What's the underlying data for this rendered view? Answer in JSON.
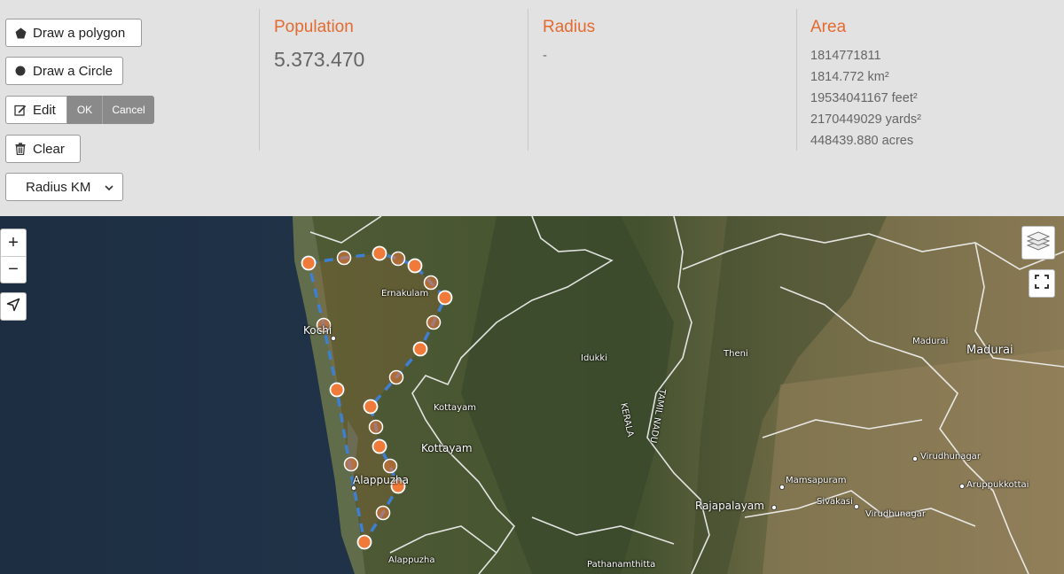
{
  "toolbar": {
    "draw_polygon": "Draw a polygon",
    "draw_circle": "Draw a Circle",
    "edit": "Edit",
    "ok": "OK",
    "cancel": "Cancel",
    "clear": "Clear",
    "unit_select": "Radius KM"
  },
  "stats": {
    "population": {
      "title": "Population",
      "value": "5.373.470"
    },
    "radius": {
      "title": "Radius",
      "value": "-"
    },
    "area": {
      "title": "Area",
      "values": [
        "1814771811",
        "1814.772 km²",
        "19534041167 feet²",
        "2170449029 yards²",
        "448439.880 acres"
      ]
    }
  },
  "map": {
    "zoom_in": "+",
    "zoom_out": "−",
    "labels": {
      "ernakulam": "Ernakulam",
      "kochi": "Kochi",
      "idukki": "Idukki",
      "theni": "Theni",
      "madurai_small": "Madurai",
      "madurai": "Madurai",
      "kottayam_small": "Kottayam",
      "kottayam": "Kottayam",
      "alappuzha": "Alappuzha",
      "alappuzha_small": "Alappuzha",
      "kerala": "KERALA",
      "tamil_nadu": "TAMIL NADU",
      "virudhunagar": "Virudhunagar",
      "aruppukkottai": "Aruppukkottai",
      "mamsapuram": "Mamsapuram",
      "sivakasi": "Sivakasi",
      "virudhunagar2": "Virudhunagar",
      "rajapalayam": "Rajapalayam",
      "pathanamthitta": "Pathanamthitta"
    },
    "colors": {
      "accent": "#e46a2f",
      "polygon_edge": "#3f7fd1",
      "vertex": "#f07a3a"
    }
  }
}
